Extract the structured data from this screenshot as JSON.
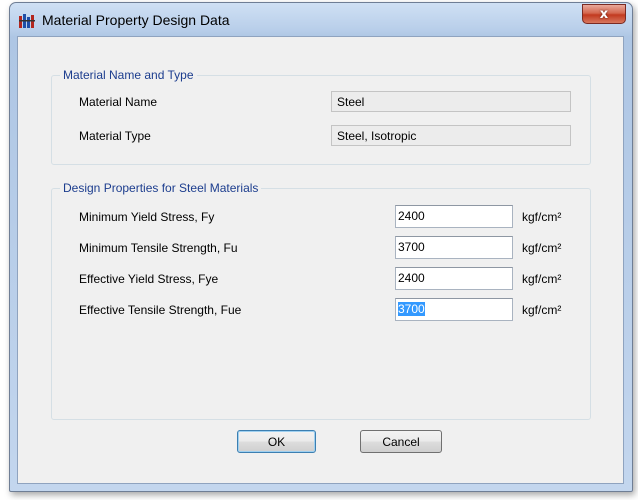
{
  "window": {
    "title": "Material Property Design Data",
    "close_glyph": "x",
    "icon": "app-icon"
  },
  "material_group": {
    "title": "Material Name and Type",
    "rows": [
      {
        "label": "Material Name",
        "value": "Steel"
      },
      {
        "label": "Material Type",
        "value": "Steel, Isotropic"
      }
    ]
  },
  "design_group": {
    "title": "Design Properties for Steel Materials",
    "rows": [
      {
        "label": "Minimum Yield Stress, Fy",
        "value": "2400",
        "unit": "kgf/cm²"
      },
      {
        "label": "Minimum Tensile Strength, Fu",
        "value": "3700",
        "unit": "kgf/cm²"
      },
      {
        "label": "Effective Yield Stress, Fye",
        "value": "2400",
        "unit": "kgf/cm²"
      },
      {
        "label": "Effective Tensile Strength, Fue",
        "value": "3700",
        "unit": "kgf/cm²"
      }
    ]
  },
  "buttons": {
    "ok_label": "OK",
    "cancel_label": "Cancel"
  },
  "colors": {
    "group_title": "#1c3d8e",
    "selection": "#3399ff",
    "close_button": "#c23a20"
  }
}
